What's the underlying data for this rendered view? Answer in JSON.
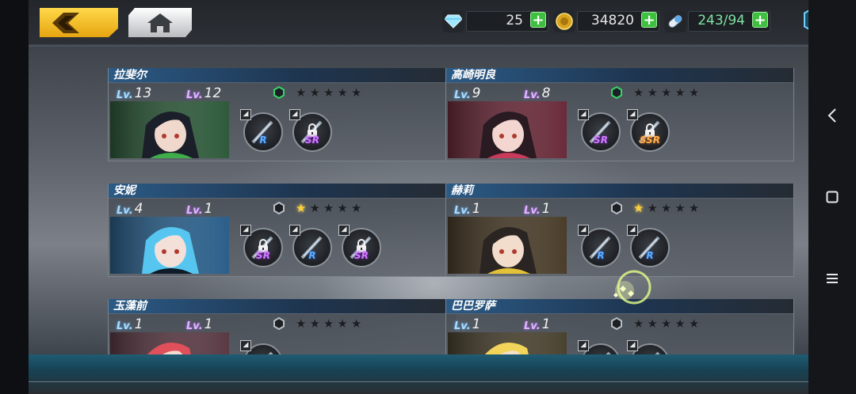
{
  "topbar": {
    "currencies": [
      {
        "icon": "diamond-icon",
        "value": "25"
      },
      {
        "icon": "gold-coin-icon",
        "value": "34820"
      },
      {
        "icon": "stamina-capsule-icon",
        "value": "243/94"
      }
    ]
  },
  "colors": {
    "accent_yellow": "#f5c22a",
    "name_bar_blue": "#2b5a85",
    "plus_green": "#3fbf3f",
    "star_gold": "#ffcf3a"
  },
  "characters": [
    {
      "name": "拉斐尔",
      "lv_blue": "13",
      "lv_purple": "12",
      "stars_lit": 0,
      "hex": "green",
      "equips": [
        {
          "rarity": "R",
          "locked": false
        },
        {
          "rarity": "SR",
          "locked": true
        }
      ]
    },
    {
      "name": "高崎明良",
      "lv_blue": "9",
      "lv_purple": "8",
      "stars_lit": 0,
      "hex": "green",
      "equips": [
        {
          "rarity": "SR",
          "locked": false
        },
        {
          "rarity": "SSR",
          "locked": true
        }
      ]
    },
    {
      "name": "安妮",
      "lv_blue": "4",
      "lv_purple": "1",
      "stars_lit": 1,
      "hex": "dark",
      "equips": [
        {
          "rarity": "SR",
          "locked": true
        },
        {
          "rarity": "R",
          "locked": false
        },
        {
          "rarity": "SR",
          "locked": true
        }
      ]
    },
    {
      "name": "赫莉",
      "lv_blue": "1",
      "lv_purple": "1",
      "stars_lit": 1,
      "hex": "dark",
      "equips": [
        {
          "rarity": "R",
          "locked": false
        },
        {
          "rarity": "R",
          "locked": false
        }
      ]
    },
    {
      "name": "玉藻前",
      "lv_blue": "1",
      "lv_purple": "1",
      "stars_lit": 0,
      "hex": "dark",
      "equips": [
        {
          "rarity": "",
          "locked": false
        }
      ]
    },
    {
      "name": "巴巴罗萨",
      "lv_blue": "1",
      "lv_purple": "1",
      "stars_lit": 0,
      "hex": "dark",
      "equips": [
        {
          "rarity": "",
          "locked": false
        },
        {
          "rarity": "",
          "locked": false
        }
      ]
    }
  ],
  "labels": {
    "lv_prefix": "Lv."
  }
}
